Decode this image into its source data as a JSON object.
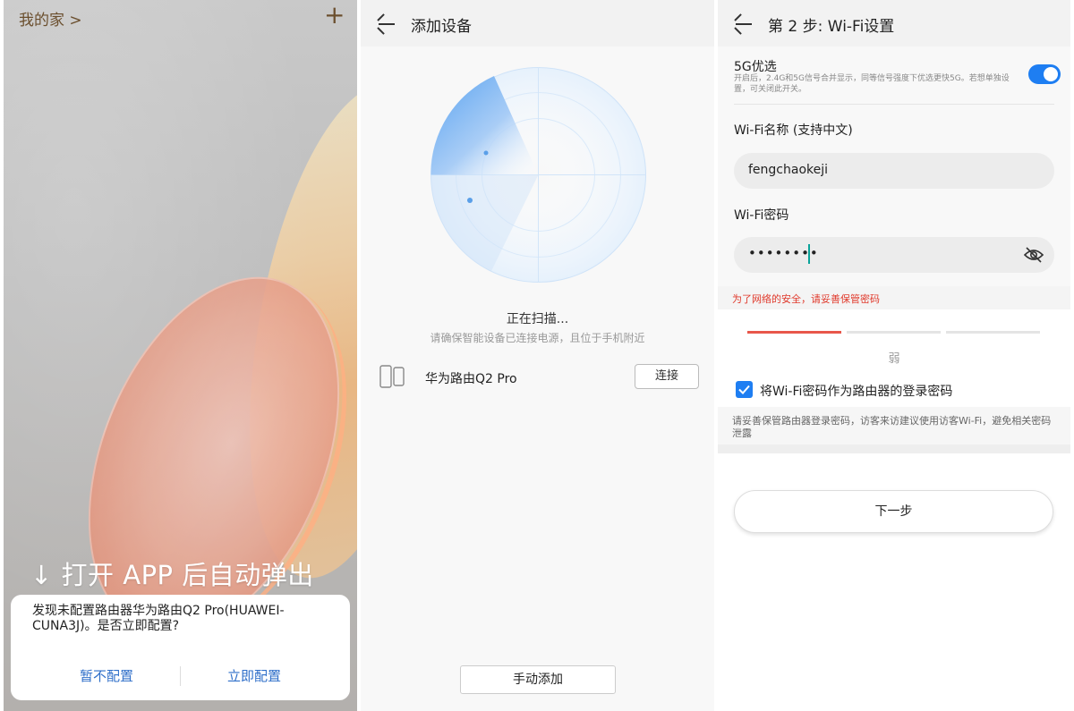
{
  "panel1": {
    "title": "我的家 >",
    "add_icon": "plus-icon",
    "caption": "↓ 打开 APP 后自动弹出",
    "dialog": {
      "message": "发现未配置路由器华为路由Q2 Pro(HUAWEI-CUNA3J)。是否立即配置?",
      "later_label": "暂不配置",
      "now_label": "立即配置"
    }
  },
  "panel2": {
    "title": "添加设备",
    "scan_status": "正在扫描...",
    "scan_hint": "请确保智能设备已连接电源，且位于手机附近",
    "device_name": "华为路由Q2 Pro",
    "connect_label": "连接",
    "manual_add_label": "手动添加"
  },
  "panel3": {
    "title": "第 2 步: Wi-Fi设置",
    "g5_label": "5G优选",
    "g5_desc": "开启后，2.4G和5G信号合并显示，同等信号强度下优选更快5G。若想单独设置，可关闭此开关。",
    "g5_enabled": true,
    "wifi_name_label": "Wi-Fi名称 (支持中文)",
    "wifi_name_value": "fengchaokeji",
    "wifi_password_label": "Wi-Fi密码",
    "wifi_password_masked": "••••••••",
    "security_warning": "为了网络的安全，请妥善保管密码",
    "strength_label": "弱",
    "strength_level": 1,
    "strength_levels_total": 3,
    "checkbox_label": "将Wi-Fi密码作为路由器的登录密码",
    "checkbox_checked": true,
    "note": "请妥善保管路由器登录密码，访客来访建议使用访客Wi-Fi，避免相关密码泄露",
    "next_label": "下一步"
  },
  "colors": {
    "accent": "#1e7ef2",
    "warning": "#e0392b",
    "strength_active": "#e8574a",
    "title_brown": "#6b4f2e"
  }
}
